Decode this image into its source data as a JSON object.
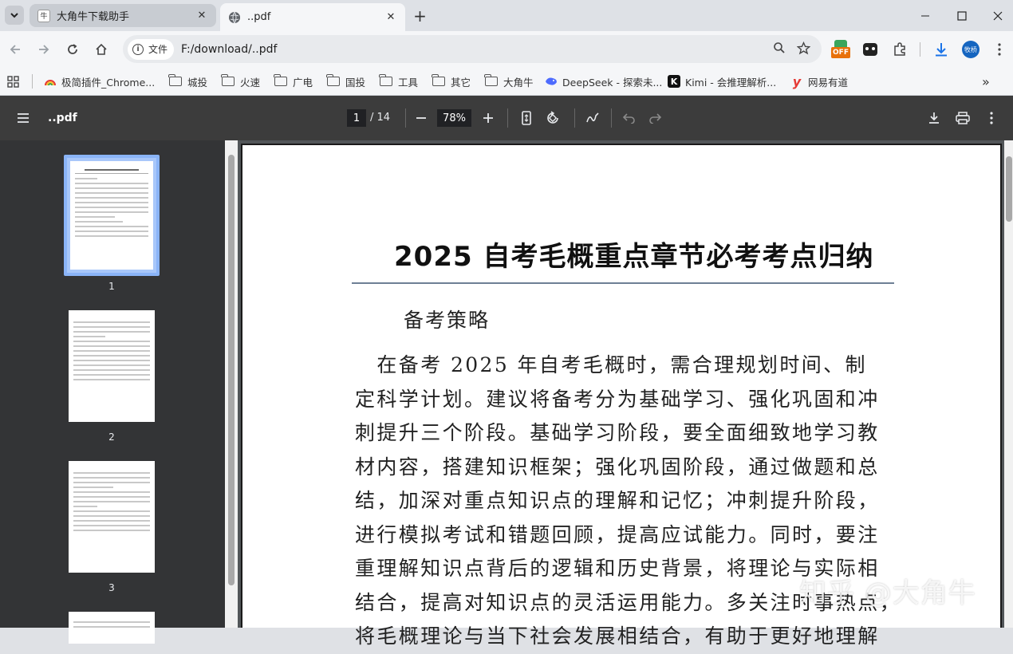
{
  "tabs": [
    {
      "title": "大角牛下载助手",
      "active": false
    },
    {
      "title": "..pdf",
      "active": true
    }
  ],
  "toolbar": {
    "chip_label": "文件",
    "url": "F:/download/..pdf",
    "profile_label": "牧桥",
    "ext_badge": "OFF"
  },
  "bookmarks": [
    {
      "label": "极简插件_Chrome...",
      "kind": "site"
    },
    {
      "label": "城投",
      "kind": "folder"
    },
    {
      "label": "火速",
      "kind": "folder"
    },
    {
      "label": "广电",
      "kind": "folder"
    },
    {
      "label": "国投",
      "kind": "folder"
    },
    {
      "label": "工具",
      "kind": "folder"
    },
    {
      "label": "其它",
      "kind": "folder"
    },
    {
      "label": "大角牛",
      "kind": "folder"
    },
    {
      "label": "DeepSeek - 探索未...",
      "kind": "site"
    },
    {
      "label": "Kimi - 会推理解析...",
      "kind": "site"
    },
    {
      "label": "网易有道",
      "kind": "site"
    }
  ],
  "pdf": {
    "title": "..pdf",
    "current_page": "1",
    "total_pages": "/ 14",
    "zoom": "78%"
  },
  "thumbnails": [
    "1",
    "2",
    "3"
  ],
  "document": {
    "title": "2025 自考毛概重点章节必考考点归纳",
    "section": "备考策略",
    "lines": [
      "　在备考 2025 年自考毛概时，需合理规划时间、制",
      "定科学计划。建议将备考分为基础学习、强化巩固和冲",
      "刺提升三个阶段。基础学习阶段，要全面细致地学习教",
      "材内容，搭建知识框架；强化巩固阶段，通过做题和总",
      "结，加深对重点知识点的理解和记忆；冲刺提升阶段，",
      "进行模拟考试和错题回顾，提高应试能力。同时，要注",
      "重理解知识点背后的逻辑和历史背景，将理论与实际相",
      "结合，提高对知识点的灵活运用能力。多关注时事热点，",
      "将毛概理论与当下社会发展相结合，有助于更好地理解"
    ]
  },
  "watermark": "知乎 @大角牛",
  "colors": {
    "tabstrip": "#dee1e6",
    "pdf_toolbar": "#3c3c3c",
    "sidebar": "#333436",
    "accent": "#8ab4f8"
  }
}
